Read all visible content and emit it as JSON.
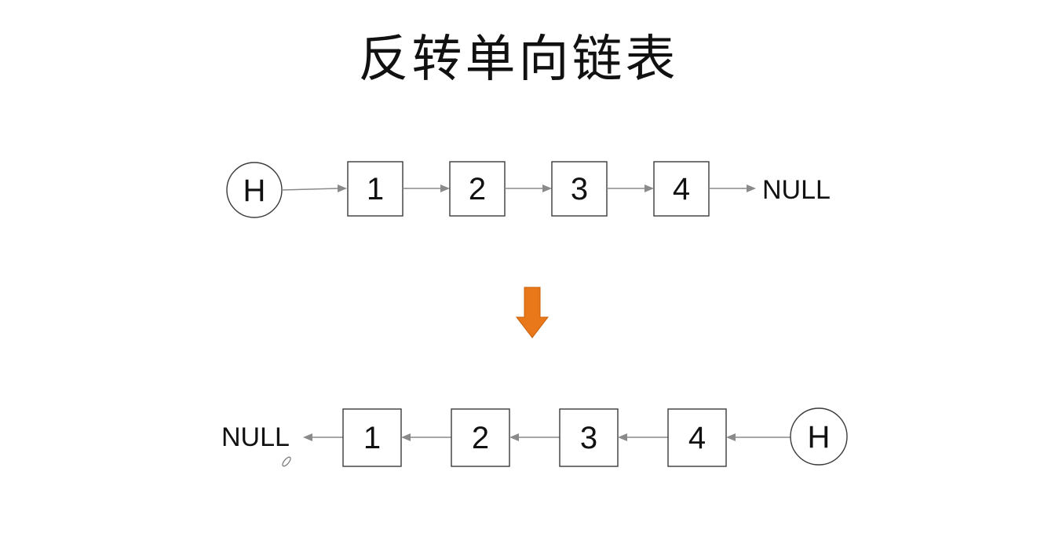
{
  "title": "反转单向链表",
  "top_list": {
    "head_label": "H",
    "nodes": [
      "1",
      "2",
      "3",
      "4"
    ],
    "null_label": "NULL"
  },
  "bottom_list": {
    "head_label": "H",
    "nodes": [
      "1",
      "2",
      "3",
      "4"
    ],
    "null_label": "NULL"
  },
  "colors": {
    "transform_arrow": "#e8781a",
    "link_arrow": "#8a8a8a",
    "node_border": "#3a3a3a"
  },
  "icons": {
    "transform": "down-arrow-icon",
    "cursor": "pencil-cursor-icon"
  }
}
